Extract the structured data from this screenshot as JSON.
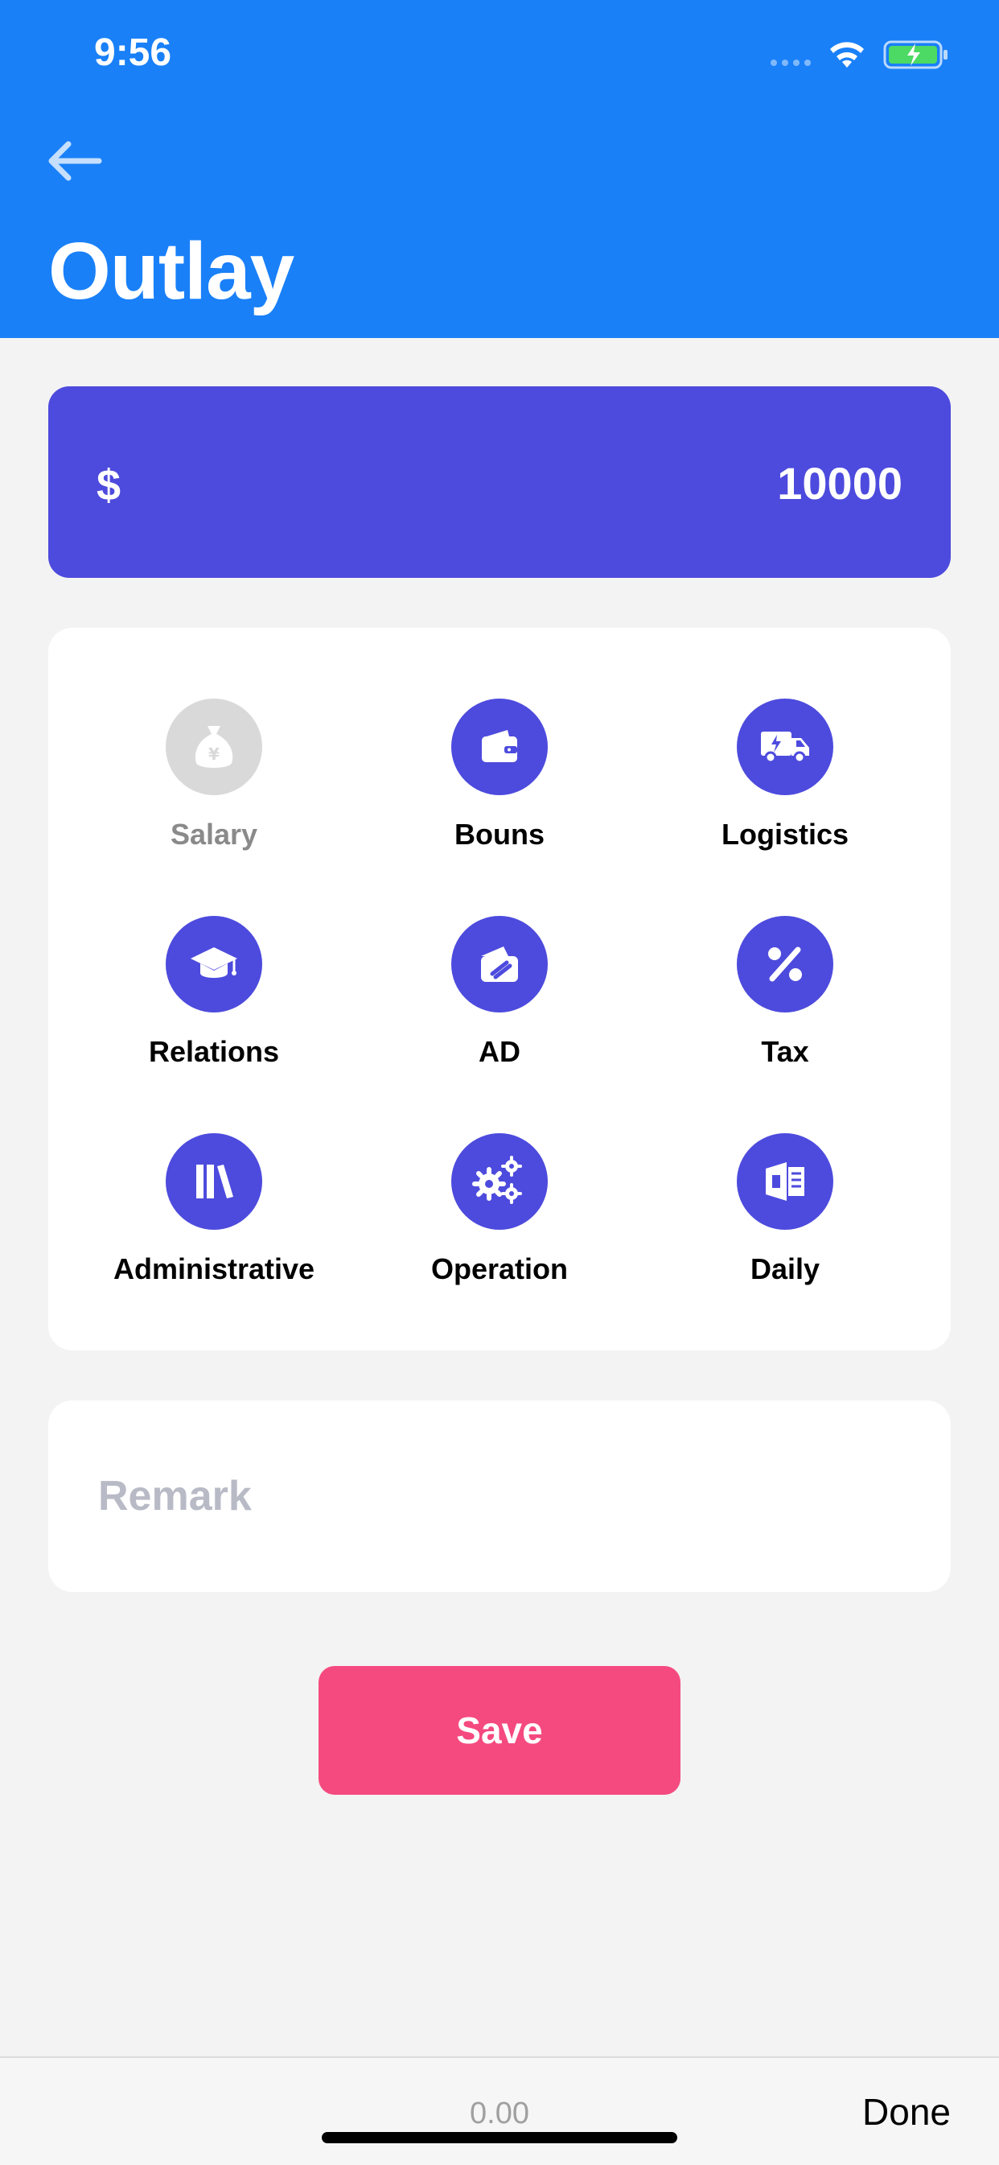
{
  "status_bar": {
    "time": "9:56"
  },
  "header": {
    "title": "Outlay"
  },
  "amount": {
    "currency": "$",
    "value": "10000"
  },
  "categories": [
    {
      "label": "Salary",
      "icon": "money-bag-icon",
      "selected": false
    },
    {
      "label": "Bouns",
      "icon": "wallet-icon",
      "selected": true
    },
    {
      "label": "Logistics",
      "icon": "delivery-truck-icon",
      "selected": true
    },
    {
      "label": "Relations",
      "icon": "graduation-cap-icon",
      "selected": true
    },
    {
      "label": "AD",
      "icon": "ad-card-icon",
      "selected": true
    },
    {
      "label": "Tax",
      "icon": "percent-icon",
      "selected": true
    },
    {
      "label": "Administrative",
      "icon": "books-icon",
      "selected": true
    },
    {
      "label": "Operation",
      "icon": "gears-icon",
      "selected": true
    },
    {
      "label": "Daily",
      "icon": "office-doc-icon",
      "selected": true
    }
  ],
  "remark": {
    "placeholder": "Remark",
    "value": ""
  },
  "save_label": "Save",
  "keyboard_toolbar": {
    "value": "0.00",
    "done_label": "Done"
  },
  "colors": {
    "header": "#1980f8",
    "accent": "#4d4bdd",
    "save": "#f54a7f",
    "disabled": "#d9d9d9"
  }
}
